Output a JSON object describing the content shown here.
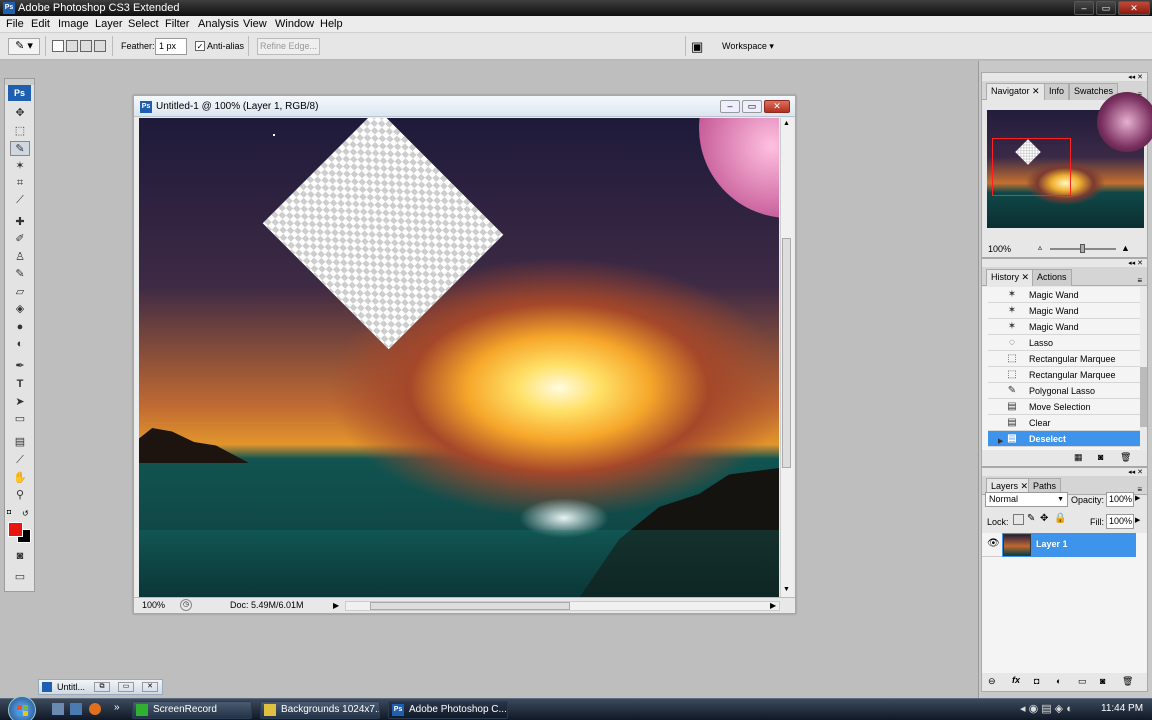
{
  "app": {
    "title": "Adobe Photoshop CS3 Extended",
    "logo": "Ps"
  },
  "menu": [
    "File",
    "Edit",
    "Image",
    "Layer",
    "Select",
    "Filter",
    "Analysis",
    "View",
    "Window",
    "Help"
  ],
  "options": {
    "feather_label": "Feather:",
    "feather_value": "1 px",
    "antialias_label": "Anti-alias",
    "antialias_checked": true,
    "refine_edge": "Refine Edge...",
    "workspace": "Workspace"
  },
  "document": {
    "title": "Untitled-1 @ 100% (Layer 1, RGB/8)",
    "zoom": "100%",
    "doc_info": "Doc: 5.49M/6.01M"
  },
  "navigator": {
    "tabs": [
      "Navigator",
      "Info",
      "Swatches"
    ],
    "zoom": "100%"
  },
  "history": {
    "tabs": [
      "History",
      "Actions"
    ],
    "items": [
      "Magic Wand",
      "Magic Wand",
      "Magic Wand",
      "Lasso",
      "Rectangular Marquee",
      "Rectangular Marquee",
      "Polygonal Lasso",
      "Move Selection",
      "Clear",
      "Deselect"
    ],
    "selected": "Deselect"
  },
  "layers": {
    "tabs": [
      "Layers",
      "Paths"
    ],
    "blend_mode": "Normal",
    "opacity_label": "Opacity:",
    "opacity": "100%",
    "lock_label": "Lock:",
    "fill_label": "Fill:",
    "fill": "100%",
    "layer_name": "Layer 1"
  },
  "minimized_doc": {
    "title": "Untitl..."
  },
  "taskbar": {
    "items": [
      "ScreenRecord",
      "Backgrounds 1024x7...",
      "Adobe Photoshop C..."
    ],
    "clock": "11:44 PM"
  },
  "colors": {
    "foreground": "#e8150e",
    "background": "#000000",
    "accent": "#3e93ea"
  }
}
